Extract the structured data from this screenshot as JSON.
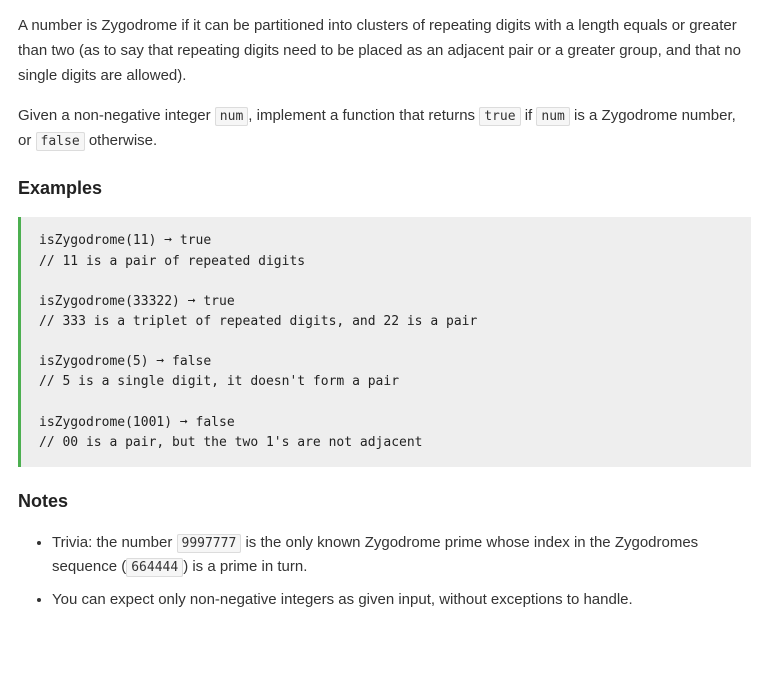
{
  "intro": {
    "p1": "A number is Zygodrome if it can be partitioned into clusters of repeating digits with a length equals or greater than two (as to say that repeating digits need to be placed as an adjacent pair or a greater group, and that no single digits are allowed).",
    "p2_a": "Given a non-negative integer ",
    "p2_code1": "num",
    "p2_b": ", implement a function that returns ",
    "p2_code2": "true",
    "p2_c": " if ",
    "p2_code3": "num",
    "p2_d": " is a Zygodrome number, or ",
    "p2_code4": "false",
    "p2_e": " otherwise."
  },
  "examples_heading": "Examples",
  "examples_code": "isZygodrome(11) ➞ true\n// 11 is a pair of repeated digits\n\nisZygodrome(33322) ➞ true\n// 333 is a triplet of repeated digits, and 22 is a pair\n\nisZygodrome(5) ➞ false\n// 5 is a single digit, it doesn't form a pair\n\nisZygodrome(1001) ➞ false\n// 00 is a pair, but the two 1's are not adjacent",
  "notes_heading": "Notes",
  "notes": {
    "n1_a": "Trivia: the number ",
    "n1_code1": "9997777",
    "n1_b": " is the only known Zygodrome prime whose index in the Zygodromes sequence (",
    "n1_code2": "664444",
    "n1_c": ") is a prime in turn.",
    "n2": "You can expect only non-negative integers as given input, without exceptions to handle."
  }
}
